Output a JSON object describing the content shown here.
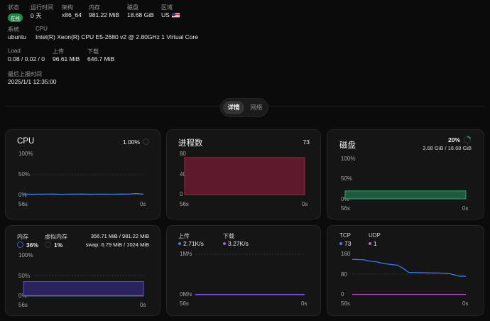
{
  "info": {
    "status": {
      "label": "状态",
      "value": "在线"
    },
    "uptime": {
      "label": "运行时间",
      "value": "0 天"
    },
    "arch": {
      "label": "架构",
      "value": "x86_64"
    },
    "memory": {
      "label": "内存",
      "value": "981.22 MiB"
    },
    "disk": {
      "label": "磁盘",
      "value": "18.68 GiB"
    },
    "region": {
      "label": "区域",
      "value": "US"
    },
    "system": {
      "label": "系统",
      "value": "ubuntu"
    },
    "cpu": {
      "label": "CPU",
      "value": "Intel(R) Xeon(R) CPU E5-2680 v2 @ 2.80GHz 1 Virtual Core"
    },
    "load": {
      "label": "Load",
      "value": "0.08 / 0.02 / 0"
    },
    "upload": {
      "label": "上传",
      "value": "96.61 MiB"
    },
    "download": {
      "label": "下载",
      "value": "646.7 MiB"
    },
    "last_report": {
      "label": "最后上报时间",
      "value": "2025/1/1 12:35:00"
    }
  },
  "tabs": {
    "detail": "详情",
    "network": "网络",
    "active": "detail"
  },
  "colors": {
    "cpu_line": "#3b82f6",
    "proc_fill": "#5e1a2b",
    "proc_stroke": "#9a2a43",
    "disk_fill": "#1d5a40",
    "disk_stroke": "#3aa36f",
    "mem_fill": "#2a235e",
    "mem_stroke": "#5b4fc2",
    "swap_line": "#e24a8a",
    "net_up": "#3b82f6",
    "net_down": "#a855f7",
    "tcp": "#3b82f6",
    "udp": "#c05ed8",
    "grid": "#3a3a3a"
  },
  "cards": {
    "cpu": {
      "title": "CPU",
      "value": "1.00%",
      "yticks": [
        "100%",
        "50%",
        "0%"
      ],
      "xstart": "56s",
      "xend": "0s"
    },
    "proc": {
      "title": "进程数",
      "value": "73",
      "yticks": [
        "80",
        "40",
        "0"
      ],
      "xstart": "56s",
      "xend": "0s"
    },
    "disk": {
      "title": "磁盘",
      "percent": "20%",
      "detail": "3.68 GiB / 18.68 GiB",
      "yticks": [
        "100%",
        "50%",
        "0%"
      ],
      "xstart": "56s",
      "xend": "0s"
    },
    "mem": {
      "mem_label": "内存",
      "mem_pct": "36%",
      "swap_label": "虚拟内存",
      "swap_pct": "1%",
      "mem_detail": "356.71 MiB / 981.22 MiB",
      "swap_detail": "swap: 6.79 MiB / 1024 MiB",
      "yticks": [
        "100%",
        "50%",
        "0%"
      ],
      "xstart": "56s",
      "xend": "0s"
    },
    "net": {
      "up_label": "上传",
      "up_value": "2.71K/s",
      "down_label": "下载",
      "down_value": "3.27K/s",
      "yticks": [
        "1M/s",
        "0M/s"
      ],
      "xstart": "56s",
      "xend": "0s"
    },
    "conn": {
      "tcp_label": "TCP",
      "tcp_value": "73",
      "udp_label": "UDP",
      "udp_value": "1",
      "yticks": [
        "160",
        "80",
        "0"
      ],
      "xstart": "56s",
      "xend": "0s"
    }
  },
  "chart_data": [
    {
      "type": "line",
      "name": "cpu",
      "ylim": [
        0,
        100
      ],
      "x": [
        56,
        0
      ],
      "values": [
        1.2,
        0.9,
        1.1,
        1.0,
        1.3,
        0.8,
        1.1,
        1.0,
        1.2,
        0.9,
        1.0,
        1.1,
        0.9,
        1.2,
        1.0,
        2.5,
        1.0
      ]
    },
    {
      "type": "area",
      "name": "processes",
      "ylim": [
        0,
        80
      ],
      "values": [
        73,
        73
      ]
    },
    {
      "type": "area",
      "name": "disk",
      "ylim": [
        0,
        100
      ],
      "values": [
        20,
        20
      ]
    },
    {
      "type": "area",
      "name": "memory",
      "ylim": [
        0,
        100
      ],
      "values": [
        36,
        36
      ],
      "swap_values": [
        1,
        1
      ]
    },
    {
      "type": "line",
      "name": "network",
      "ylim": [
        0,
        1
      ],
      "up_values": [
        0.003,
        0.003
      ],
      "down_values": [
        0.003,
        0.003
      ]
    },
    {
      "type": "line",
      "name": "connections",
      "ylim": [
        0,
        160
      ],
      "tcp_values": [
        140,
        139,
        138,
        133,
        131,
        126,
        122,
        119,
        117,
        103,
        88,
        88,
        87,
        87,
        86,
        86,
        85,
        84,
        78,
        73,
        73
      ],
      "udp_values": [
        1,
        1
      ]
    }
  ]
}
